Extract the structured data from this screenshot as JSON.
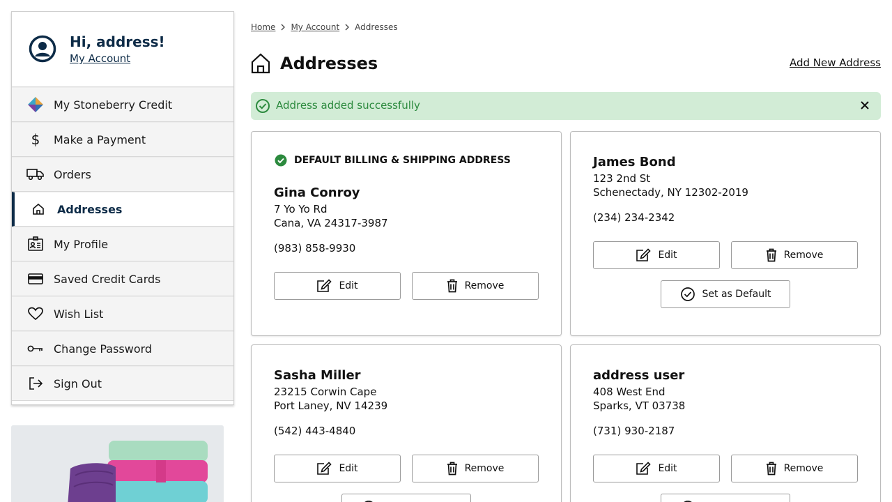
{
  "sidebar": {
    "greeting": "Hi, address!",
    "account_link": "My Account",
    "items": [
      {
        "label": "My Stoneberry Credit",
        "icon": "stoneberry-logo-icon"
      },
      {
        "label": "Make a Payment",
        "icon": "dollar-icon"
      },
      {
        "label": "Orders",
        "icon": "truck-icon"
      },
      {
        "label": "Addresses",
        "icon": "home-icon",
        "active": true
      },
      {
        "label": "My Profile",
        "icon": "profile-card-icon"
      },
      {
        "label": "Saved Credit Cards",
        "icon": "credit-card-icon"
      },
      {
        "label": "Wish List",
        "icon": "heart-icon"
      },
      {
        "label": "Change Password",
        "icon": "key-icon"
      },
      {
        "label": "Sign Out",
        "icon": "sign-out-icon"
      }
    ]
  },
  "breadcrumb": [
    "Home",
    "My Account",
    "Addresses"
  ],
  "page": {
    "title": "Addresses",
    "add_link": "Add New Address"
  },
  "alert": {
    "message": "Address added successfully"
  },
  "labels": {
    "default_badge": "DEFAULT BILLING & SHIPPING ADDRESS",
    "edit": "Edit",
    "remove": "Remove",
    "set_default": "Set as Default"
  },
  "addresses": [
    {
      "name": "Gina Conroy",
      "street": "7 Yo Yo Rd",
      "city": "Cana, VA 24317-3987",
      "phone": "(983) 858-9930",
      "is_default": true
    },
    {
      "name": "James Bond",
      "street": "123 2nd St",
      "city": "Schenectady, NY 12302-2019",
      "phone": "(234) 234-2342",
      "is_default": false
    },
    {
      "name": "Sasha Miller",
      "street": "23215 Corwin Cape",
      "city": "Port Laney, NV 14239",
      "phone": "(542) 443-4840",
      "is_default": false
    },
    {
      "name": "address user",
      "street": "408 West End",
      "city": "Sparks, VT 03738",
      "phone": "(731) 930-2187",
      "is_default": false
    }
  ],
  "colors": {
    "brand_navy": "#0d2b47",
    "success_bg": "#d2ecd6",
    "success_text": "#2c8a3e"
  }
}
